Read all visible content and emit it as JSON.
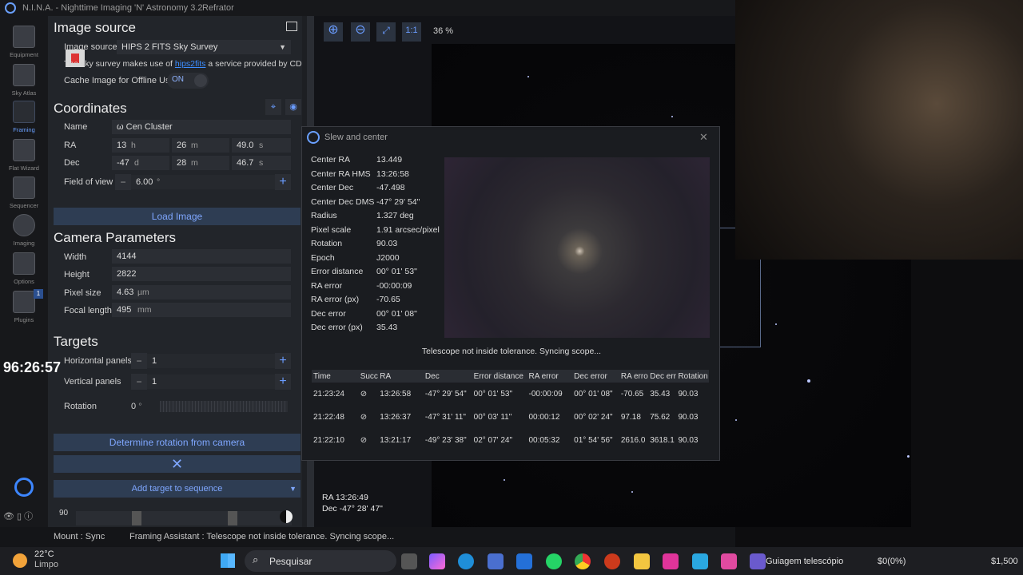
{
  "window": {
    "title": "N.I.N.A. - Nighttime Imaging 'N' Astronomy 3.2",
    "profile": "Refrator"
  },
  "sidebar": [
    {
      "label": "Equipment"
    },
    {
      "label": "Sky Atlas"
    },
    {
      "label": "Framing"
    },
    {
      "label": "Flat Wizard"
    },
    {
      "label": "Sequencer"
    },
    {
      "label": "Imaging"
    },
    {
      "label": "Options"
    },
    {
      "label": "Plugins",
      "badge": "1"
    }
  ],
  "image_source": {
    "heading": "Image source",
    "label": "Image source",
    "selected": "HIPS 2 FITS Sky Survey",
    "note_prefix": "The sky survey makes use of",
    "note_link": "hips2fits",
    "note_suffix": "a service provided by CDS",
    "cache_label": "Cache Image for Offline Use",
    "cache_toggle": "ON"
  },
  "coordinates": {
    "heading": "Coordinates",
    "name_label": "Name",
    "name_value": "ω Cen Cluster",
    "ra_label": "RA",
    "ra_h": "13",
    "ra_h_unit": "h",
    "ra_m": "26",
    "ra_m_unit": "m",
    "ra_s": "49.0",
    "ra_s_unit": "s",
    "dec_label": "Dec",
    "dec_d": "-47",
    "dec_d_unit": "d",
    "dec_m": "28",
    "dec_m_unit": "m",
    "dec_s": "46.7",
    "dec_s_unit": "s",
    "fov_label": "Field of view",
    "fov_value": "6.00",
    "fov_unit": "°",
    "load_button": "Load Image"
  },
  "camera": {
    "heading": "Camera Parameters",
    "width_label": "Width",
    "width_value": "4144",
    "height_label": "Height",
    "height_value": "2822",
    "pixel_label": "Pixel size",
    "pixel_value": "4.63",
    "pixel_unit": "µm",
    "focal_label": "Focal length",
    "focal_value": "495",
    "focal_unit": "mm"
  },
  "targets": {
    "heading": "Targets",
    "hpanels_label": "Horizontal panels",
    "hpanels_value": "1",
    "vpanels_label": "Vertical panels",
    "vpanels_value": "1",
    "rotation_label": "Rotation",
    "rotation_value": "0",
    "rotation_unit": "°",
    "determine_button": "Determine rotation from camera",
    "add_button": "Add target to sequence",
    "slider_value": "90"
  },
  "toolbar": {
    "zoom_label": "1:1",
    "zoom_percent": "36 %"
  },
  "overlay": {
    "ra": "RA  13:26:49",
    "dec": "Dec  -47° 28' 47\""
  },
  "dialog": {
    "title": "Slew and center",
    "fields": [
      {
        "k": "Center RA",
        "v": "13.449"
      },
      {
        "k": "Center RA HMS",
        "v": "13:26:58"
      },
      {
        "k": "Center Dec",
        "v": "-47.498"
      },
      {
        "k": "Center Dec DMS",
        "v": "-47° 29' 54\""
      },
      {
        "k": "Radius",
        "v": "1.327 deg"
      },
      {
        "k": "Pixel scale",
        "v": "1.91 arcsec/pixel"
      },
      {
        "k": "Rotation",
        "v": "90.03"
      },
      {
        "k": "Epoch",
        "v": "J2000"
      },
      {
        "k": "Error distance",
        "v": "00° 01' 53\""
      },
      {
        "k": "RA error",
        "v": "-00:00:09"
      },
      {
        "k": "RA error (px)",
        "v": "-70.65"
      },
      {
        "k": "Dec error",
        "v": "00° 01' 08\""
      },
      {
        "k": "Dec error (px)",
        "v": "35.43"
      }
    ],
    "message": "Telescope not inside tolerance. Syncing scope...",
    "columns": [
      "Time",
      "Succ",
      "RA",
      "Dec",
      "Error distance",
      "RA error",
      "Dec error",
      "RA erro",
      "Dec err",
      "Rotation"
    ],
    "rows": [
      [
        "21:23:24",
        "⊘",
        "13:26:58",
        "-47° 29' 54\"",
        "00° 01' 53\"",
        "-00:00:09",
        "00° 01' 08\"",
        "-70.65",
        "35.43",
        "90.03"
      ],
      [
        "21:22:48",
        "⊘",
        "13:26:37",
        "-47° 31' 11\"",
        "00° 03' 11\"",
        "00:00:12",
        "00° 02' 24\"",
        "97.18",
        "75.62",
        "90.03"
      ],
      [
        "21:22:10",
        "⊘",
        "13:21:17",
        "-49° 23' 38\"",
        "02° 07' 24\"",
        "00:05:32",
        "01° 54' 56\"",
        "2616.0",
        "3618.1",
        "90.03"
      ]
    ]
  },
  "status": {
    "left": "Mount :  Sync",
    "right": "Framing Assistant :  Telescope not inside tolerance. Syncing scope..."
  },
  "timer": "96:26:57",
  "taskbar": {
    "weather_temp": "22°C",
    "weather_desc": "Limpo",
    "search": "Pesquisar",
    "app_label": "Guiagem telescópio",
    "counter": "$0(0%)",
    "amount": "$1,500"
  }
}
